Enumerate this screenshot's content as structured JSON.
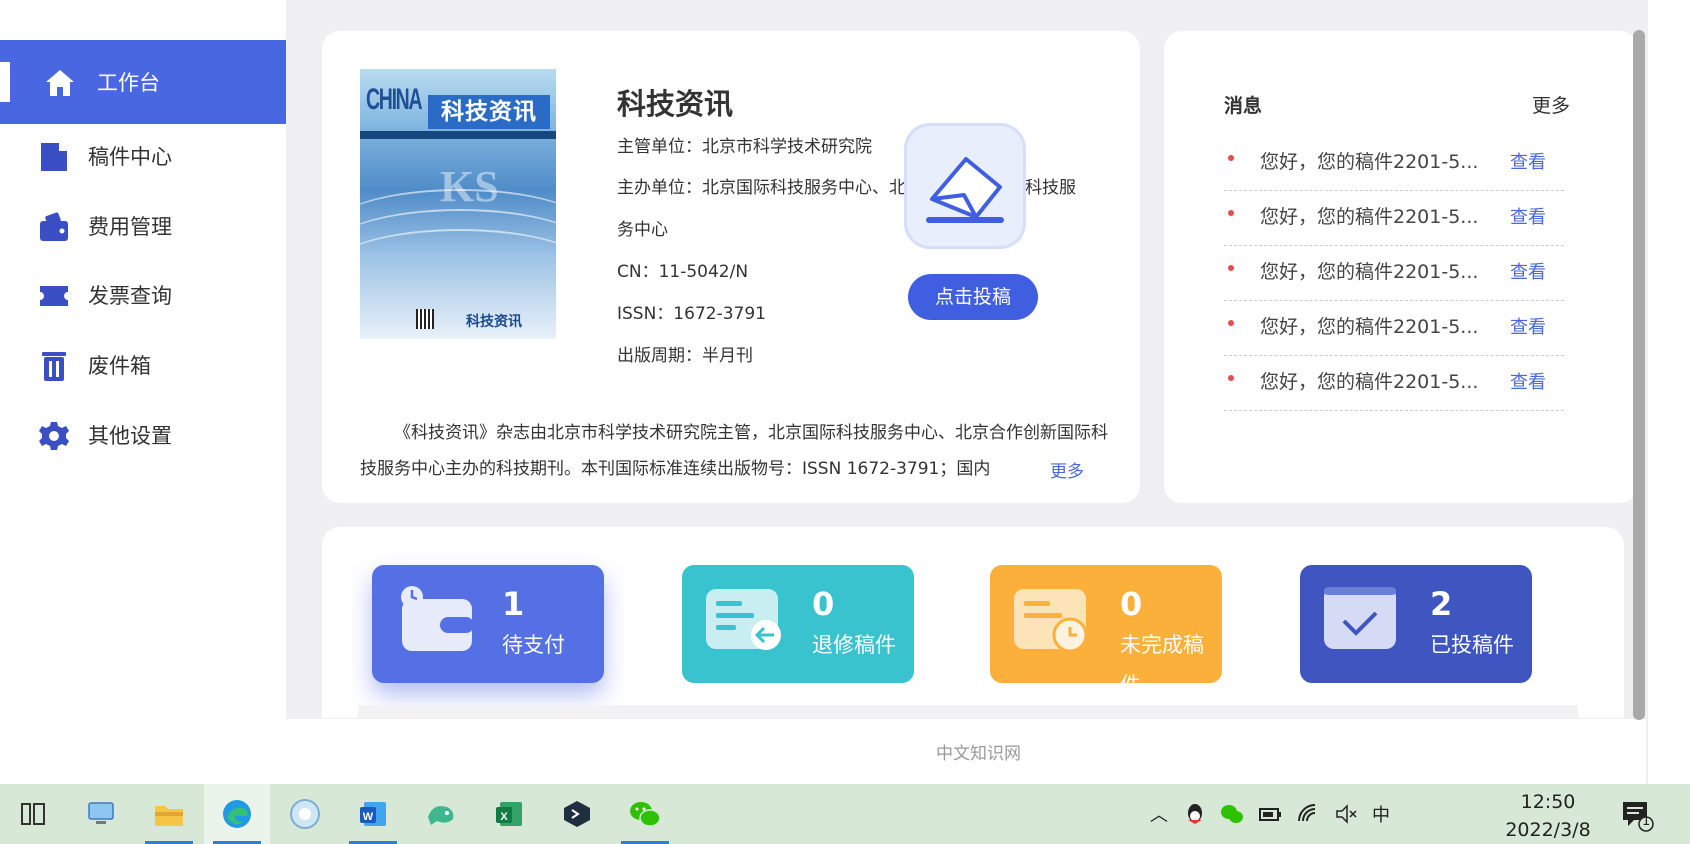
{
  "sidebar": {
    "items": [
      {
        "label": "工作台",
        "icon": "home-icon",
        "active": true
      },
      {
        "label": "稿件中心",
        "icon": "document-icon"
      },
      {
        "label": "费用管理",
        "icon": "wallet-icon"
      },
      {
        "label": "发票查询",
        "icon": "ticket-icon"
      },
      {
        "label": "废件箱",
        "icon": "trash-icon"
      },
      {
        "label": "其他设置",
        "icon": "gear-icon"
      }
    ]
  },
  "journal": {
    "cover": {
      "title": "科技资讯",
      "china": "CHINA",
      "logo": "科技资讯"
    },
    "title": "科技资讯",
    "supervisor": "主管单位：北京市科学技术研究院",
    "sponsor_line1": "主办单位：北京国际科技服务中心、北京合作创新国际科技服",
    "sponsor_line2": "务中心",
    "cn": "CN：11-5042/N",
    "issn": "ISSN：1672-3791",
    "period": "出版周期：半月刊",
    "description": "《科技资讯》杂志由北京市科学技术研究院主管，北京国际科技服务中心、北京合作创新国际科技服务中心主办的科技期刊。本刊国际标准连续出版物号：ISSN 1672-3791；国内",
    "more": "更多",
    "submit_label": "点击投稿"
  },
  "messages": {
    "title": "消息",
    "more": "更多",
    "view_label": "查看",
    "items": [
      "您好，您的稿件2201-5...",
      "您好，您的稿件2201-5...",
      "您好，您的稿件2201-5...",
      "您好，您的稿件2201-5...",
      "您好，您的稿件2201-5..."
    ]
  },
  "stats": [
    {
      "value": "1",
      "label": "待支付",
      "color": "#5470e4"
    },
    {
      "value": "0",
      "label": "退修稿件",
      "color": "#39c3cf"
    },
    {
      "value": "0",
      "label": "未完成稿件",
      "color": "#fbb03b"
    },
    {
      "value": "2",
      "label": "已投稿件",
      "color": "#3f55c0"
    }
  ],
  "footer": {
    "text": "中文知识网"
  },
  "taskbar": {
    "apps": [
      "task-view-icon",
      "this-pc-icon",
      "file-explorer-icon",
      "edge-icon",
      "photo-app-icon",
      "word-icon",
      "dolphin-app-icon",
      "excel-icon",
      "terminal-app-icon",
      "wechat-icon"
    ],
    "tray": {
      "ime": "中",
      "time": "12:50",
      "date": "2022/3/8",
      "notifications": "1"
    }
  },
  "colors": {
    "accent": "#4a67e2",
    "background": "#f0f0f2",
    "taskbar": "#d7e8d7"
  }
}
